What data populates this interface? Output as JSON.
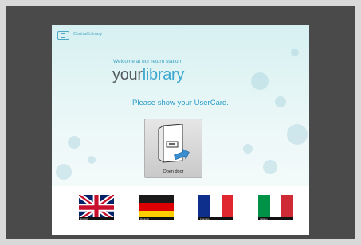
{
  "header": {
    "logo_text": "Central Library"
  },
  "main": {
    "welcome": "Welcome at our return station",
    "brand_part1": "your",
    "brand_part2": "library",
    "prompt": "Please show your UserCard.",
    "door_button_label": "Open door"
  },
  "languages": [
    {
      "name": "English",
      "icon": "uk-flag-icon"
    },
    {
      "name": "Deutsch",
      "icon": "german-flag-icon"
    },
    {
      "name": "Français",
      "icon": "french-flag-icon"
    },
    {
      "name": "Italiano",
      "icon": "italian-flag-icon"
    }
  ],
  "colors": {
    "accent": "#3aa7cf",
    "bezel": "#4a4a4a",
    "background_top": "#d6f0f1"
  }
}
